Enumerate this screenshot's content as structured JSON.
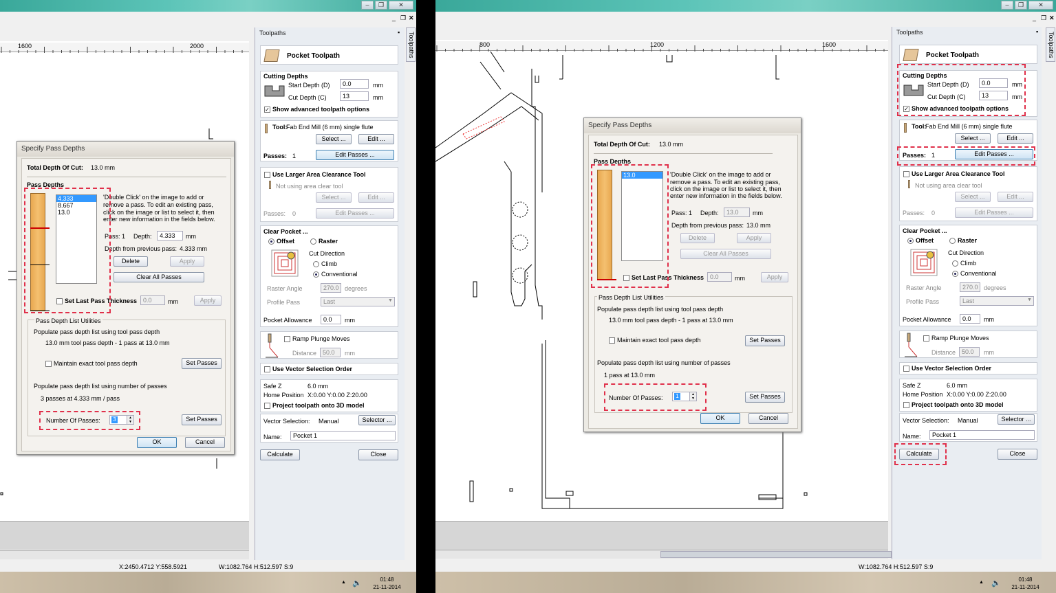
{
  "left": {
    "ruler_labels": [
      "1600",
      "2000"
    ],
    "panel": {
      "title": "Toolpaths",
      "tab_label": "Toolpaths",
      "pocket_title": "Pocket Toolpath",
      "cutting_depths": "Cutting Depths",
      "start_depth_label": "Start Depth (D)",
      "start_depth_value": "0.0",
      "cut_depth_label": "Cut Depth (C)",
      "cut_depth_value": "13",
      "unit": "mm",
      "show_advanced": "Show advanced toolpath options",
      "tool_label": "Tool:",
      "tool_value": "Fab End Mill (6 mm) single flute",
      "select_btn": "Select ...",
      "edit_btn": "Edit ...",
      "passes_label": "Passes:",
      "passes_value": "1",
      "edit_passes_btn": "Edit Passes ...",
      "larger_area": "Use Larger Area Clearance Tool",
      "not_using": "Not using area clear tool",
      "passes2_value": "0",
      "clear_pocket": "Clear Pocket ...",
      "offset": "Offset",
      "raster": "Raster",
      "cut_direction": "Cut Direction",
      "climb": "Climb",
      "conventional": "Conventional",
      "raster_angle": "Raster Angle",
      "raster_angle_value": "270.0",
      "degrees": "degrees",
      "profile_pass": "Profile Pass",
      "profile_pass_value": "Last",
      "pocket_allowance": "Pocket Allowance",
      "pocket_allowance_value": "0.0",
      "ramp": "Ramp Plunge Moves",
      "distance": "Distance",
      "distance_value": "50.0",
      "vector_order": "Use Vector Selection Order",
      "safe_z": "Safe Z",
      "safe_z_value": "6.0 mm",
      "home": "Home Position",
      "home_value": "X:0.00 Y:0.00 Z:20.00",
      "project": "Project toolpath onto 3D model",
      "vector_selection": "Vector Selection:",
      "vector_selection_value": "Manual",
      "selector_btn": "Selector ...",
      "name_label": "Name:",
      "name_value": "Pocket 1",
      "calculate": "Calculate",
      "close": "Close"
    },
    "dialog": {
      "title": "Specify Pass Depths",
      "total_label": "Total Depth Of Cut:",
      "total_value": "13.0 mm",
      "pass_depths": "Pass Depths",
      "list": [
        "4.333",
        "8.667",
        "13.0"
      ],
      "instructions": [
        "'Double Click' on the image to add or",
        "remove a pass. To edit an existing pass,",
        "click on the image or list to select it, then",
        "enter new information in the fields below."
      ],
      "pass_label": "Pass: 1",
      "depth_label": "Depth:",
      "depth_value": "4.333",
      "mm": "mm",
      "dfp_label": "Depth from previous pass:",
      "dfp_value": "4.333 mm",
      "delete": "Delete",
      "apply": "Apply",
      "clear_all": "Clear All Passes",
      "set_last": "Set Last Pass Thickness",
      "set_last_value": "0.0",
      "utilities": "Pass Depth List Utilities",
      "populate_tool": "Populate pass depth list using tool pass depth",
      "tool_info": "13.0 mm tool pass depth - 1 pass at 13.0 mm",
      "maintain": "Maintain exact tool pass depth",
      "set_passes": "Set Passes",
      "populate_number": "Populate pass depth list using number of passes",
      "number_info": "3 passes at 4.333 mm / pass",
      "number_label": "Number Of Passes:",
      "number_value": "3",
      "ok": "OK",
      "cancel": "Cancel"
    },
    "status": {
      "coords": "X:2450.4712 Y:558.5921",
      "size": "W:1082.764  H:512.597  S:9"
    },
    "clock": {
      "time": "01:48",
      "date": "21-11-2014"
    }
  },
  "right": {
    "ruler_labels": [
      "800",
      "1200",
      "1600"
    ],
    "panel": {
      "title": "Toolpaths",
      "tab_label": "Toolpaths",
      "pocket_title": "Pocket Toolpath",
      "cutting_depths": "Cutting Depths",
      "start_depth_label": "Start Depth (D)",
      "start_depth_value": "0.0",
      "cut_depth_label": "Cut Depth (C)",
      "cut_depth_value": "13",
      "unit": "mm",
      "show_advanced": "Show advanced toolpath options",
      "tool_label": "Tool:",
      "tool_value": "Fab End Mill (6 mm) single flute",
      "select_btn": "Select ...",
      "edit_btn": "Edit ...",
      "passes_label": "Passes:",
      "passes_value": "1",
      "edit_passes_btn": "Edit Passes ...",
      "larger_area": "Use Larger Area Clearance Tool",
      "not_using": "Not using area clear tool",
      "passes2_value": "0",
      "clear_pocket": "Clear Pocket ...",
      "offset": "Offset",
      "raster": "Raster",
      "cut_direction": "Cut Direction",
      "climb": "Climb",
      "conventional": "Conventional",
      "raster_angle": "Raster Angle",
      "raster_angle_value": "270.0",
      "degrees": "degrees",
      "profile_pass": "Profile Pass",
      "profile_pass_value": "Last",
      "pocket_allowance": "Pocket Allowance",
      "pocket_allowance_value": "0.0",
      "ramp": "Ramp Plunge Moves",
      "distance": "Distance",
      "distance_value": "50.0",
      "vector_order": "Use Vector Selection Order",
      "safe_z": "Safe Z",
      "safe_z_value": "6.0 mm",
      "home": "Home Position",
      "home_value": "X:0.00 Y:0.00 Z:20.00",
      "project": "Project toolpath onto 3D model",
      "vector_selection": "Vector Selection:",
      "vector_selection_value": "Manual",
      "selector_btn": "Selector ...",
      "name_label": "Name:",
      "name_value": "Pocket 1",
      "calculate": "Calculate",
      "close": "Close"
    },
    "dialog": {
      "title": "Specify Pass Depths",
      "total_label": "Total Depth Of Cut:",
      "total_value": "13.0 mm",
      "pass_depths": "Pass Depths",
      "list": [
        "13.0"
      ],
      "instructions": [
        "'Double Click' on the image to add or",
        "remove a pass. To edit an existing pass,",
        "click on the image or list to select it, then",
        "enter new information in the fields below."
      ],
      "pass_label": "Pass: 1",
      "depth_label": "Depth:",
      "depth_value": "13.0",
      "mm": "mm",
      "dfp_label": "Depth from previous pass:",
      "dfp_value": "13.0 mm",
      "delete": "Delete",
      "apply": "Apply",
      "clear_all": "Clear All Passes",
      "set_last": "Set Last Pass Thickness",
      "set_last_value": "0.0",
      "utilities": "Pass Depth List Utilities",
      "populate_tool": "Populate pass depth list using tool pass depth",
      "tool_info": "13.0 mm tool pass depth - 1 pass at 13.0 mm",
      "maintain": "Maintain exact tool pass depth",
      "set_passes": "Set Passes",
      "populate_number": "Populate pass depth list using number of passes",
      "number_info": "1 pass at 13.0 mm",
      "number_label": "Number Of Passes:",
      "number_value": "1",
      "ok": "OK",
      "cancel": "Cancel"
    },
    "status": {
      "size": "W:1082.764  H:512.597  S:9"
    },
    "clock": {
      "time": "01:48",
      "date": "21-11-2014"
    }
  },
  "colors": {
    "highlight_dash": "#e0304a",
    "selection": "#3399ff",
    "depth_bar": "#f4c070"
  }
}
